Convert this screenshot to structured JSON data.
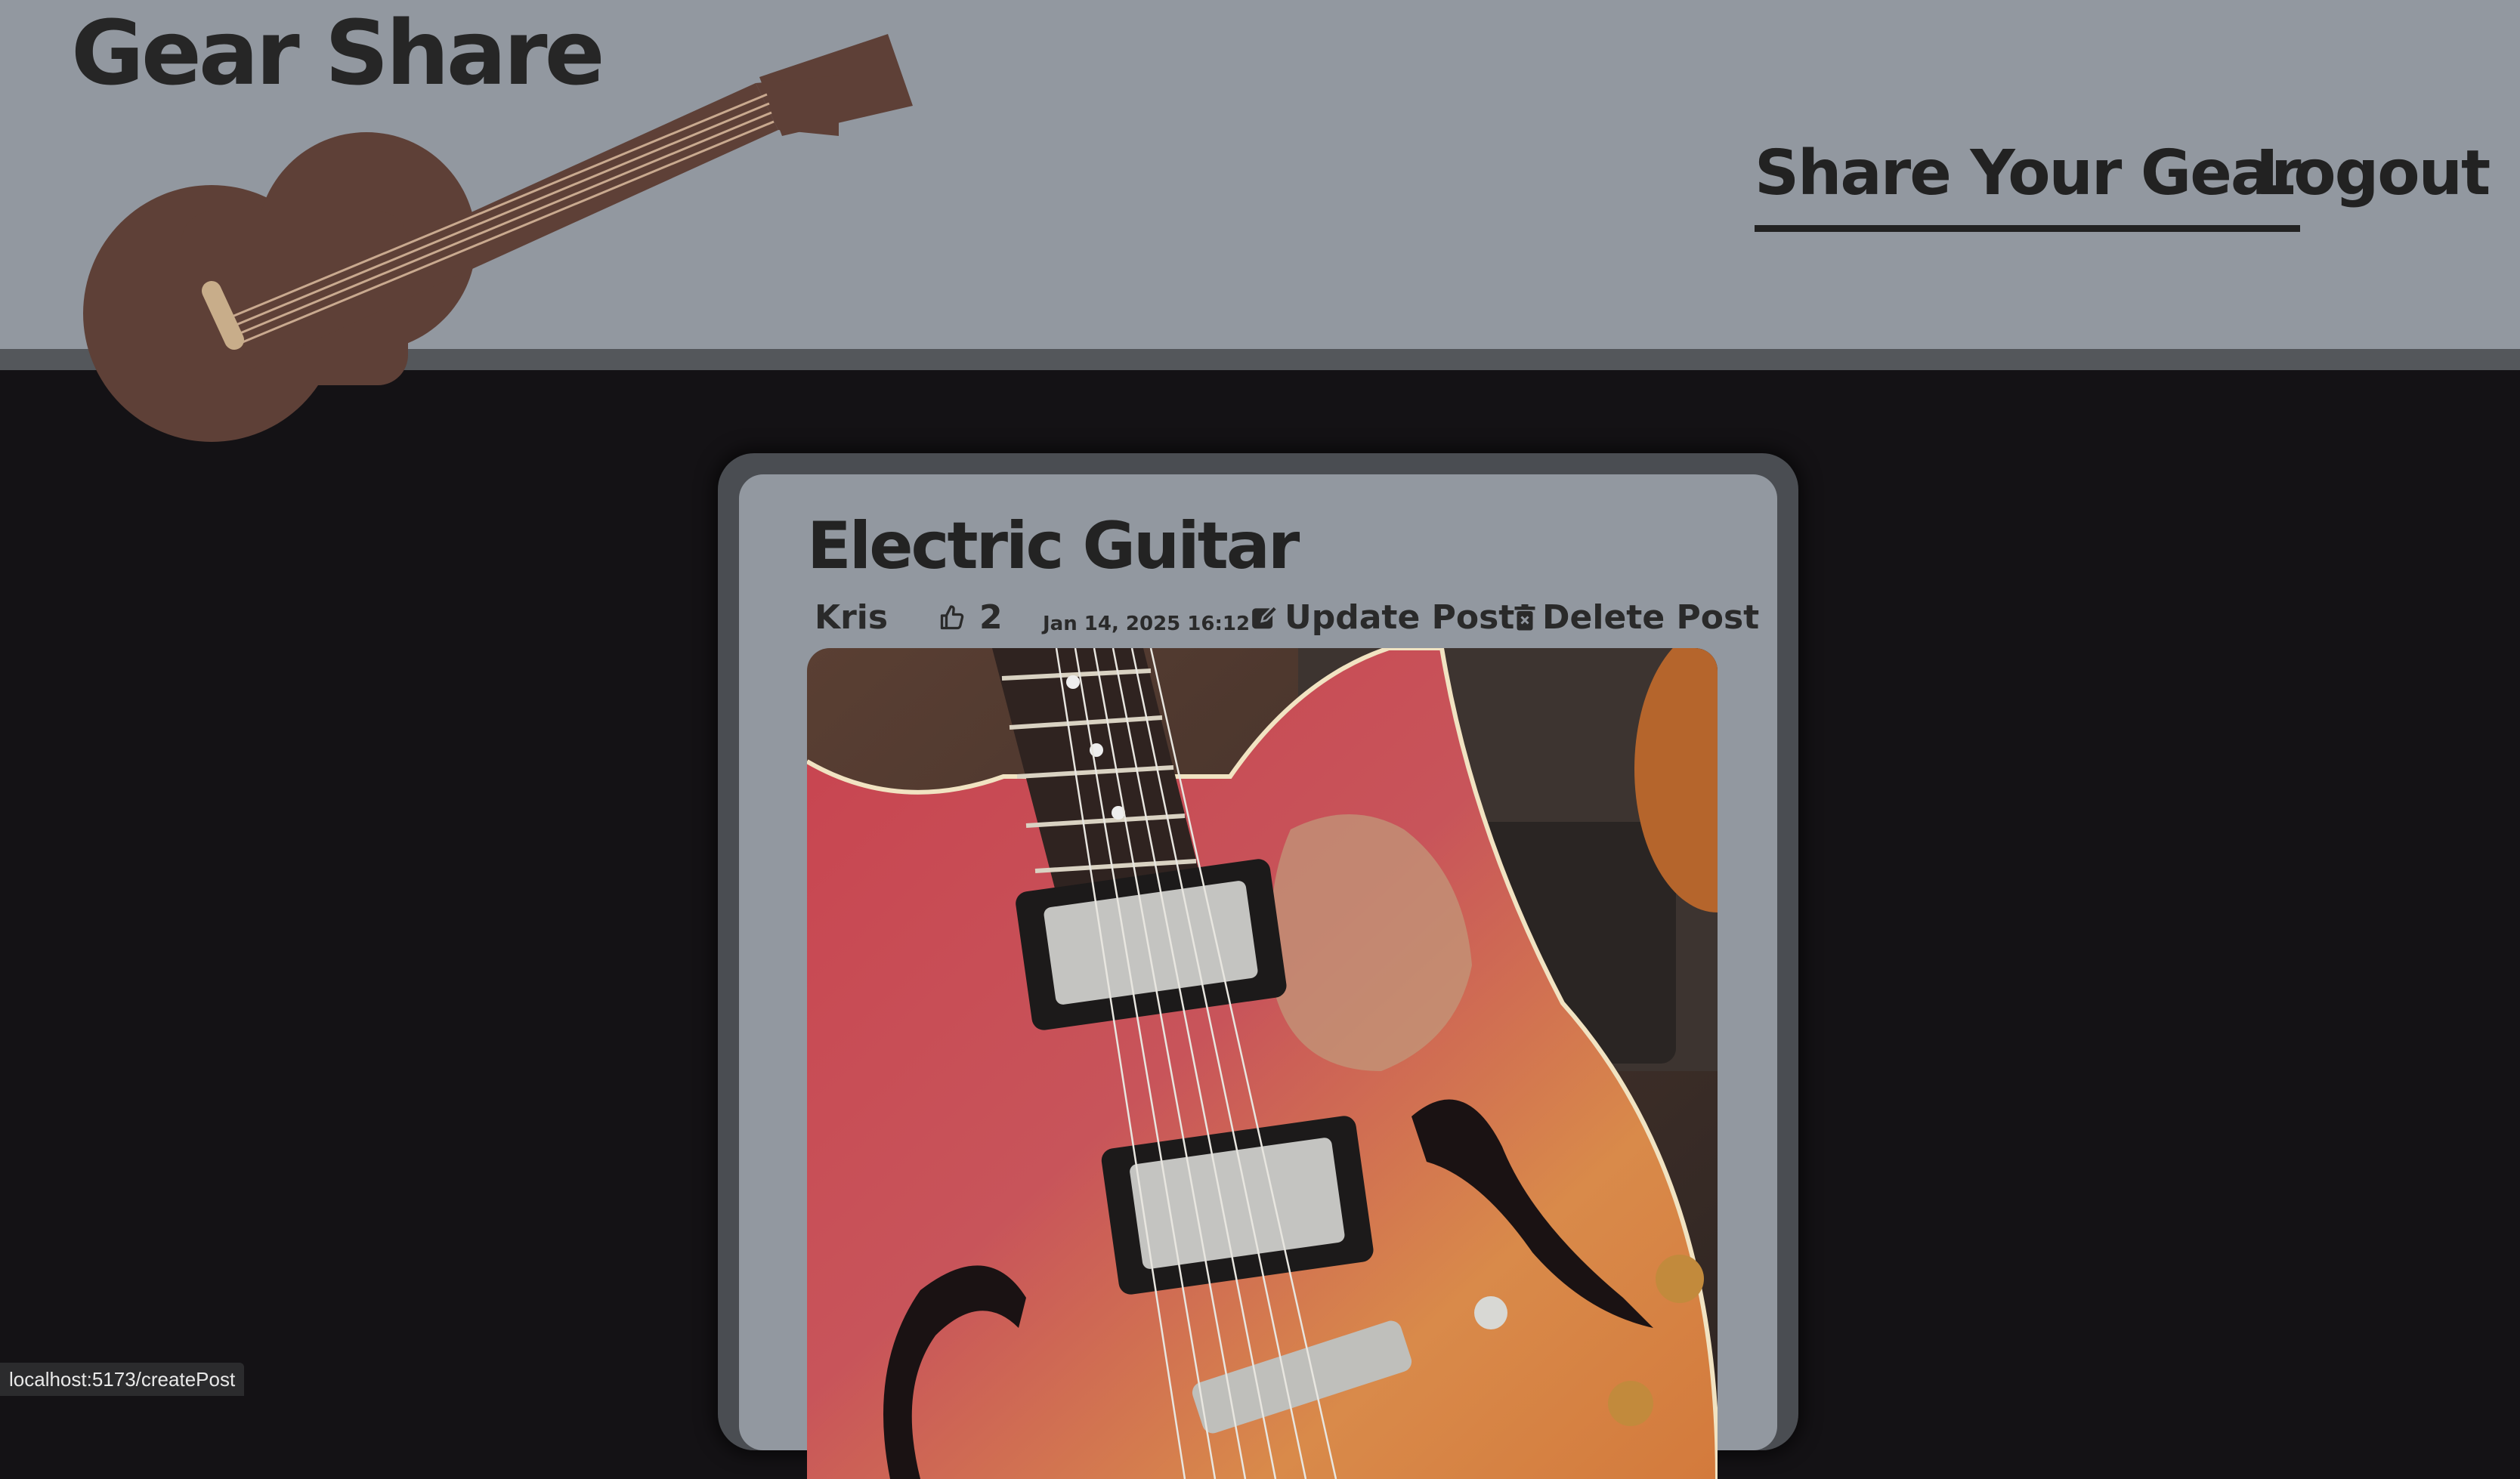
{
  "header": {
    "site_title": "Gear Share",
    "logo_icon": "guitar-icon"
  },
  "nav": {
    "share_label": "Share Your Gear",
    "logout_label": "Logout"
  },
  "post": {
    "title": "Electric Guitar",
    "author": "Kris",
    "likes": "2",
    "date": "Jan 14, 2025 16:12",
    "update_label": "Update Post",
    "delete_label": "Delete Post"
  },
  "status_bar": {
    "url": "localhost:5173/createPost"
  },
  "colors": {
    "header_bg": "#9298a0",
    "page_bg": "#141215",
    "logo_brown": "#5e4037",
    "text_dark": "#232323"
  }
}
